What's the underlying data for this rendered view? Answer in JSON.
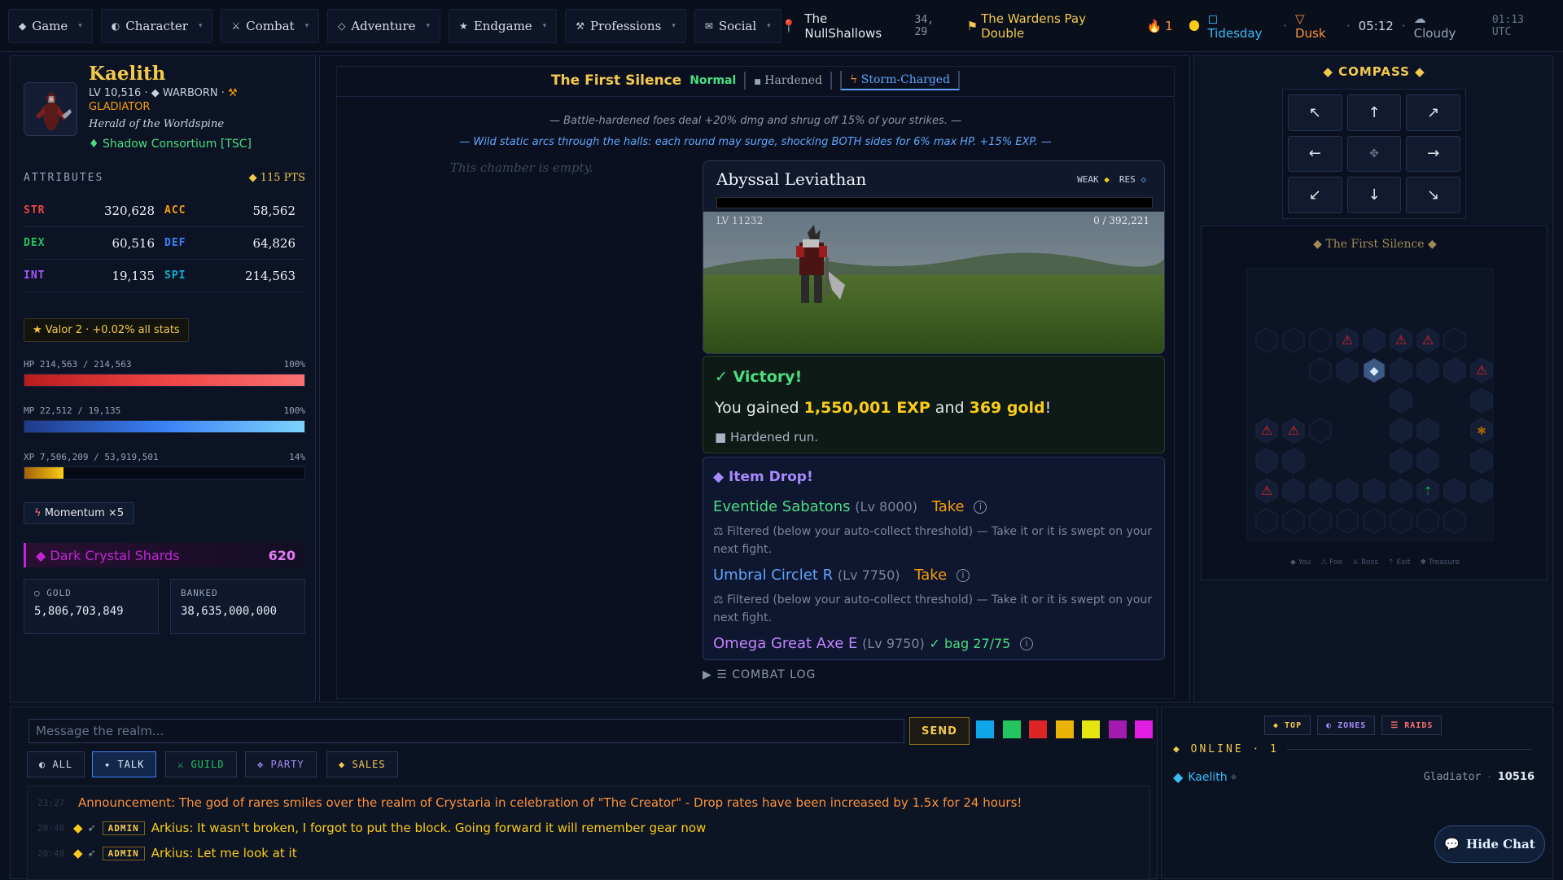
{
  "nav": [
    {
      "icon": "◆",
      "label": "Game"
    },
    {
      "icon": "◐",
      "label": "Character"
    },
    {
      "icon": "⚔",
      "label": "Combat"
    },
    {
      "icon": "◇",
      "label": "Adventure"
    },
    {
      "icon": "★",
      "label": "Endgame"
    },
    {
      "icon": "⚒",
      "label": "Professions"
    },
    {
      "icon": "✉",
      "label": "Social"
    }
  ],
  "status": {
    "location": "The NullShallows",
    "coords": "34, 29",
    "event": "The Wardens Pay Double",
    "streak": "1",
    "tide": "Tidesday",
    "dusk": "Dusk",
    "clock": "05:12",
    "weather": "Cloudy",
    "utc": "01:13 UTC"
  },
  "character": {
    "name": "Kaelith",
    "level_text": "LV 10,516",
    "race": "WARBORN",
    "class": "GLADIATOR",
    "title": "Herald of the Worldspine",
    "guild": "Shadow Consortium [TSC]"
  },
  "attributes": {
    "header": "ATTRIBUTES",
    "points": "115 PTS",
    "rows": [
      [
        {
          "k": "STR",
          "v": "320,628",
          "c": "#ef4444"
        },
        {
          "k": "ACC",
          "v": "58,562",
          "c": "#f59e0b"
        }
      ],
      [
        {
          "k": "DEX",
          "v": "60,516",
          "c": "#22c55e"
        },
        {
          "k": "DEF",
          "v": "64,826",
          "c": "#3b82f6"
        }
      ],
      [
        {
          "k": "INT",
          "v": "19,135",
          "c": "#a855f7"
        },
        {
          "k": "SPI",
          "v": "214,563",
          "c": "#06b6d4"
        }
      ]
    ]
  },
  "valor": "Valor 2 · +0.02% all stats",
  "bars": {
    "hp": {
      "label": "HP 214,563 / 214,563",
      "pct_text": "100%",
      "fill": 1.0
    },
    "mp": {
      "label": "MP 22,512 / 19,135",
      "pct_text": "100%",
      "fill": 1.0
    },
    "xp": {
      "label": "XP 7,506,209 / 53,919,501",
      "pct_text": "14%",
      "fill": 0.14
    }
  },
  "momentum": "Momentum ×5",
  "shards": {
    "name": "Dark Crystal Shards",
    "count": "620"
  },
  "wallet": {
    "gold_label": "GOLD",
    "gold": "5,806,703,849",
    "bank_label": "BANKED",
    "bank": "38,635,000,000"
  },
  "fight": {
    "title": "The First Silence",
    "difficulty": "Normal",
    "tag_hardened": "Hardened",
    "tag_storm": "Storm-Charged",
    "mod1": "— Battle-hardened foes deal +20% dmg and shrug off 15% of your strikes. —",
    "mod2": "— Wild static arcs through the halls: each round may surge, shocking BOTH sides for 6% max HP. +15% EXP. —",
    "empty": "This chamber is empty."
  },
  "boss": {
    "name": "Abyssal Leviathan",
    "weak": "WEAK",
    "res": "RES",
    "level": "LV 11232",
    "hp": "0 / 392,221",
    "hp_fill": 0
  },
  "victory": {
    "title": "✓ Victory!",
    "pre": "You gained ",
    "exp": "1,550,001 EXP",
    "mid": " and ",
    "gold": "369 gold",
    "post": "!",
    "run": "Hardened run."
  },
  "drops": {
    "title": "◆ Item Drop!",
    "take": "Take",
    "filtered": "Filtered (below your auto-collect threshold) — Take it or it is swept on your next fight.",
    "items": [
      {
        "name": "Eventide Sabatons",
        "lv": "(Lv 8000)",
        "color": "#4ade80"
      },
      {
        "name": "Umbral Circlet R",
        "lv": "(Lv 7750)",
        "color": "#60a5fa"
      },
      {
        "name": "Omega Great Axe E",
        "lv": "(Lv 9750)",
        "color": "#c084fc"
      }
    ],
    "bag": "✓ bag 27/75"
  },
  "combat_log": "▶ ☰ COMBAT LOG",
  "compass": {
    "title": "◆ COMPASS ◆",
    "buttons": [
      "↖",
      "↑",
      "↗",
      "←",
      "✥",
      "→",
      "↙",
      "↓",
      "↘"
    ]
  },
  "minimap": {
    "title": "◆ The First Silence ◆",
    "legend": [
      "◆ You",
      "⚠ Foe",
      "⚔ Boss",
      "⇡ Exit",
      "✱ Treasure"
    ]
  },
  "chat": {
    "placeholder": "Message the realm...",
    "send": "SEND",
    "colors": [
      "#0ea5e9",
      "#22c55e",
      "#dc2626",
      "#eab308",
      "#e5e510",
      "#a21caf",
      "#e11de1"
    ],
    "tabs": [
      {
        "label": "◐ ALL",
        "color": "#cbd5e1"
      },
      {
        "label": "✦ TALK",
        "color": "#e0f2fe",
        "active": true
      },
      {
        "label": "⚔ GUILD",
        "color": "#22c55e"
      },
      {
        "label": "✥ PARTY",
        "color": "#a78bfa"
      },
      {
        "label": "◆ SALES",
        "color": "#f2c94c"
      }
    ],
    "messages": [
      {
        "ts": "23:27",
        "text": "Announcement: The god of rares smiles over the realm of Crystaria in celebration of \"The Creator\" - Drop rates have been increased by 1.5x for 24 hours!",
        "color": "#fb923c"
      },
      {
        "ts": "20:48",
        "admin": "ADMIN",
        "text": "Arkius: It wasn't broken, I forgot to put the block. Going forward it will remember gear now",
        "color": "#facc15"
      },
      {
        "ts": "20:48",
        "admin": "ADMIN",
        "text": "Arkius: Let me look at it",
        "color": "#facc15"
      }
    ]
  },
  "online": {
    "tabs": [
      {
        "label": "◆ TOP",
        "color": "#f2c94c"
      },
      {
        "label": "◐ ZONES",
        "color": "#a78bfa"
      },
      {
        "label": "☰ RAIDS",
        "color": "#f87171"
      }
    ],
    "header": "◆ ONLINE · 1",
    "player": {
      "name": "Kaelith",
      "class": "Gladiator",
      "level": "10516"
    }
  },
  "hide_chat": "Hide Chat"
}
